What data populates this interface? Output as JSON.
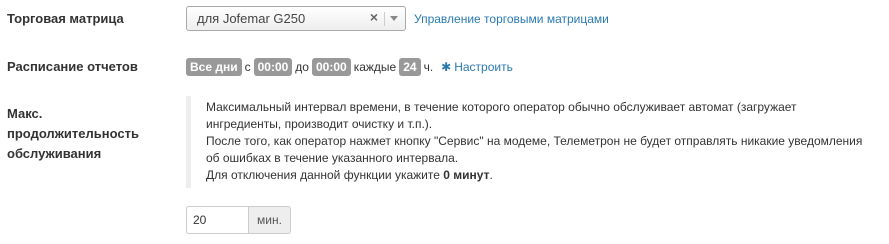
{
  "matrix": {
    "label": "Торговая матрица",
    "selected": "для Jofemar G250",
    "clear_symbol": "×",
    "manage_link": "Управление торговыми матрицами"
  },
  "schedule": {
    "label": "Расписание отчетов",
    "days": "Все дни",
    "from_text": "с",
    "from_time": "00:00",
    "to_text": "до",
    "to_time": "00:00",
    "every_text": "каждые",
    "interval": "24",
    "unit": "ч.",
    "config_link": "Настроить",
    "config_icon": "gear-icon"
  },
  "maintenance": {
    "label_line1": "Макс.",
    "label_line2": "продолжительность",
    "label_line3": "обслуживания",
    "note_line1": "Максимальный интервал времени, в течение которого оператор обычно обслуживает автомат (загружает",
    "note_line2": "ингредиенты, производит очистку и т.п.).",
    "note_line3": "После того, как оператор нажмет кнопку \"Сервис\" на модеме, Телеметрон не будет отправлять никакие уведомления",
    "note_line4": "об ошибках в течение указанного интервала.",
    "note_line5_prefix": "Для отключения данной функции укажите ",
    "note_line5_bold": "0 минут",
    "note_line5_suffix": ".",
    "value": "20",
    "unit": "мин."
  }
}
